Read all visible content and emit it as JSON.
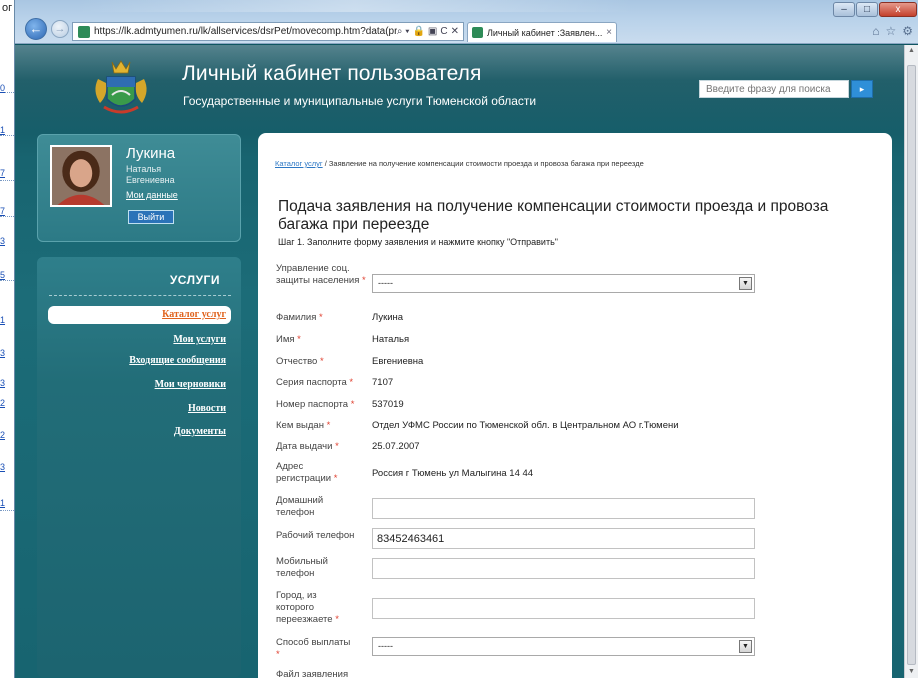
{
  "background_doc": {
    "top_text": "ог",
    "stubs": [
      "0",
      "1",
      "7",
      "7",
      "3",
      "5",
      "1",
      "3",
      "3",
      "2",
      "2",
      "3",
      "1"
    ]
  },
  "browser": {
    "address": "https://lk.admtyumen.ru/lk/allservices/dsrPet/movecomp.htm?data(provid",
    "address_tools": [
      "⌕ ▾",
      "🔒",
      "▣",
      "C",
      "✕"
    ],
    "tab_title": "Личный кабинет :Заявлен...",
    "tab_close": "×",
    "win_buttons": [
      "–",
      "□",
      "x"
    ],
    "ie_icons": [
      "⌂",
      "☆",
      "⚙"
    ],
    "back": "←",
    "forward": "→"
  },
  "header": {
    "title": "Личный кабинет пользователя",
    "subtitle": "Государственные и муниципальные услуги Тюменской области",
    "search_placeholder": "Введите фразу для поиска",
    "search_button": "▸"
  },
  "profile": {
    "last_name": "Лукина",
    "first_name": "Наталья",
    "middle_name": "Евгениевна",
    "my_data": "Мои данные",
    "logout": "Выйти"
  },
  "nav": {
    "title": "УСЛУГИ",
    "items": [
      {
        "label": "Каталог услуг",
        "active": true
      },
      {
        "label": "Мои услуги",
        "active": false
      },
      {
        "label": "Входящие сообщения",
        "active": false
      },
      {
        "label": "Мои черновики",
        "active": false
      },
      {
        "label": "Новости",
        "active": false
      },
      {
        "label": "Документы",
        "active": false
      }
    ]
  },
  "content": {
    "breadcrumb_link": "Каталог услуг",
    "breadcrumb_rest": " / Заявление на получение компенсации стоимости проезда и провоза багажа при переезде",
    "heading": "Подача заявления на получение компенсации стоимости проезда и провоза багажа при переезде",
    "step": "Шаг 1. Заполните форму заявления и нажмите кнопку \"Отправить\"",
    "required_mark": " *",
    "fields": {
      "social_dept": {
        "label": "Управление соц. защиты населения",
        "value": "-----"
      },
      "surname": {
        "label": "Фамилия",
        "value": "Лукина"
      },
      "name": {
        "label": "Имя",
        "value": "Наталья"
      },
      "patronymic": {
        "label": "Отчество",
        "value": "Евгениевна"
      },
      "passport_series": {
        "label": "Серия паспорта",
        "value": "7107"
      },
      "passport_number": {
        "label": "Номер паспорта",
        "value": "537019"
      },
      "issued_by": {
        "label": "Кем выдан",
        "value": "Отдел УФМС России по Тюменской обл. в Центральном АО г.Тюмени"
      },
      "issue_date": {
        "label": "Дата выдачи",
        "value": "25.07.2007"
      },
      "address": {
        "label": "Адрес регистрации",
        "value": "Россия г Тюмень ул Малыгина 14 44"
      },
      "home_phone": {
        "label": "Домашний телефон",
        "value": ""
      },
      "work_phone": {
        "label": "Рабочий телефон",
        "value": "83452463461"
      },
      "mobile_phone": {
        "label": "Мобильный телефон",
        "value": ""
      },
      "from_city": {
        "label": "Город, из которого переезжаете",
        "value": ""
      },
      "payment_method": {
        "label": "Способ выплаты",
        "value": "-----"
      },
      "application_file": {
        "label": "Файл заявления"
      }
    }
  },
  "colors": {
    "page_bg": "#176470",
    "accent_link": "#2c77c4",
    "active_nav": "#e0631e",
    "required": "#e04030"
  }
}
